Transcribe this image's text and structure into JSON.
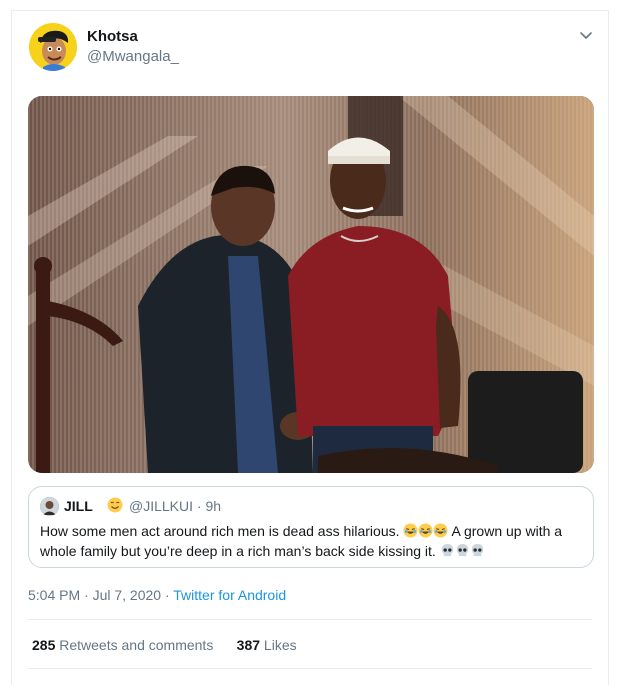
{
  "tweet": {
    "author_name": "Khotsa",
    "author_handle": "@Mwangala_",
    "timestamp": "5:04 PM · Jul 7, 2020",
    "separator": " · ",
    "client": "Twitter for Android",
    "caret_icon": "chevron-down-icon"
  },
  "quoted_tweet": {
    "author_name": "JILL",
    "author_handle": "@JILLKUI",
    "separator": " · ",
    "age": "9h",
    "text_part1": "How some men act around rich men is dead ass hilarious.",
    "text_part2": "A grown up with a whole family but you’re deep in a rich man’s back side kissing it.",
    "emoji_laugh": "rolling-on-floor-laughing-emoji",
    "emoji_skull": "skull-emoji",
    "emoji_name": "smiling-face-emoji"
  },
  "stats": {
    "retweets_count": "285",
    "retweets_label": "Retweets and comments",
    "likes_count": "387",
    "likes_label": "Likes"
  },
  "colors": {
    "link": "#1b95e0",
    "secondary_text": "#657786",
    "border": "#e6ecf0"
  }
}
